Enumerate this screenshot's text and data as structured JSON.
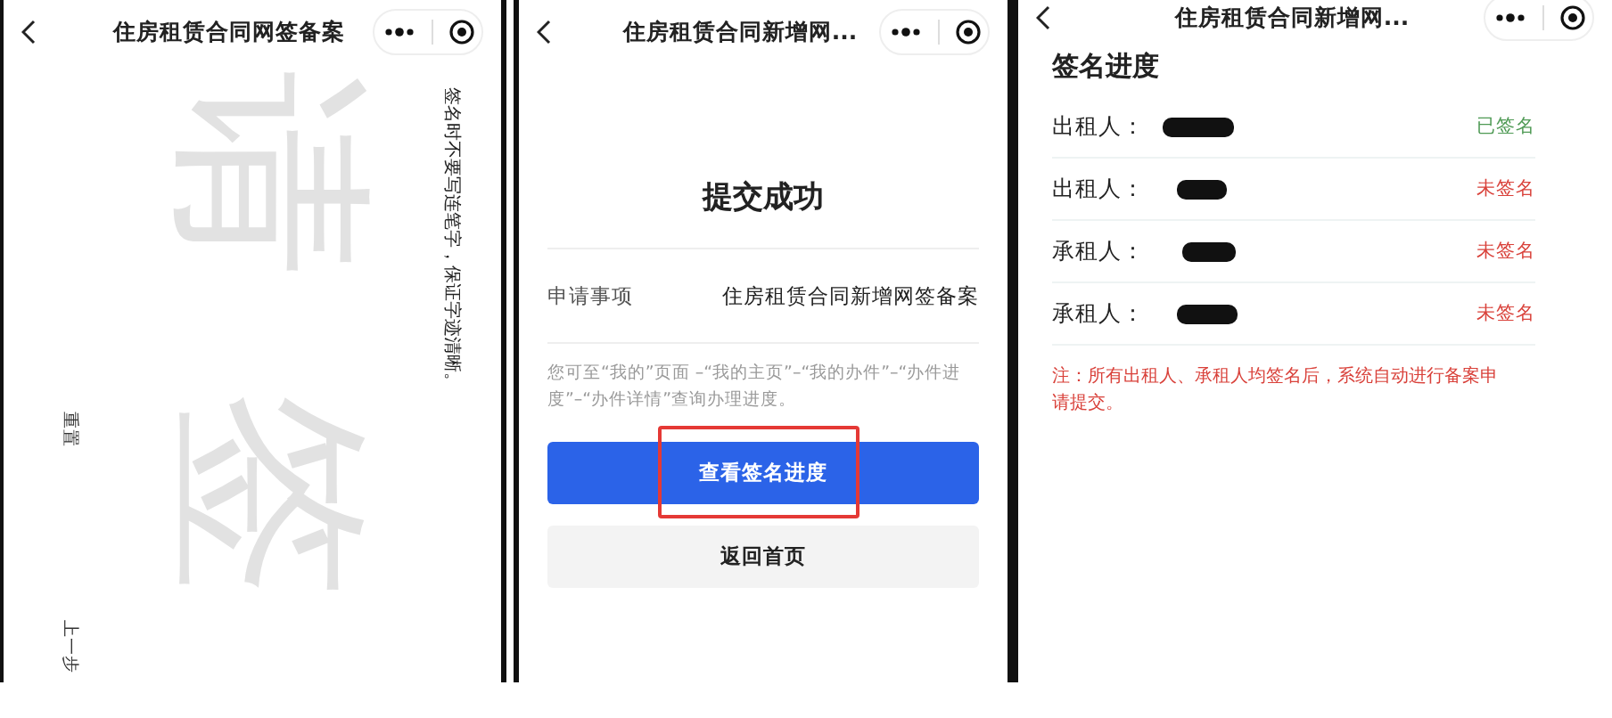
{
  "screens": [
    {
      "kind": "signature",
      "title": "住房租赁合同网签备案",
      "hint": "签名时不要写连笔字，保证字迹清晰。",
      "watermark": "请签",
      "buttons": [
        "重置",
        "上一步"
      ]
    },
    {
      "kind": "submitted",
      "title": "住房租赁合同新增网...",
      "heading": "提交成功",
      "field": {
        "label": "申请事项",
        "value": "住房租赁合同新增网签备案"
      },
      "note": "您可至“我的”页面 –“我的主页”–“我的办件”–“办件进度”–“办件详情”查询办理进度。",
      "primary_button": {
        "label": "查看签名进度",
        "highlighted": true
      },
      "secondary_button": "返回首页"
    },
    {
      "kind": "progress",
      "title": "住房租赁合同新增网...",
      "heading": "签名进度",
      "signers": [
        {
          "role": "出租人：",
          "status": "已签名",
          "signed": true
        },
        {
          "role": "出租人：",
          "status": "未签名",
          "signed": false
        },
        {
          "role": "承租人：",
          "status": "未签名",
          "signed": false
        },
        {
          "role": "承租人：",
          "status": "未签名",
          "signed": false
        }
      ],
      "note": "注：所有出租人、承租人均签名后，系统自动进行备案申请提交。"
    }
  ]
}
